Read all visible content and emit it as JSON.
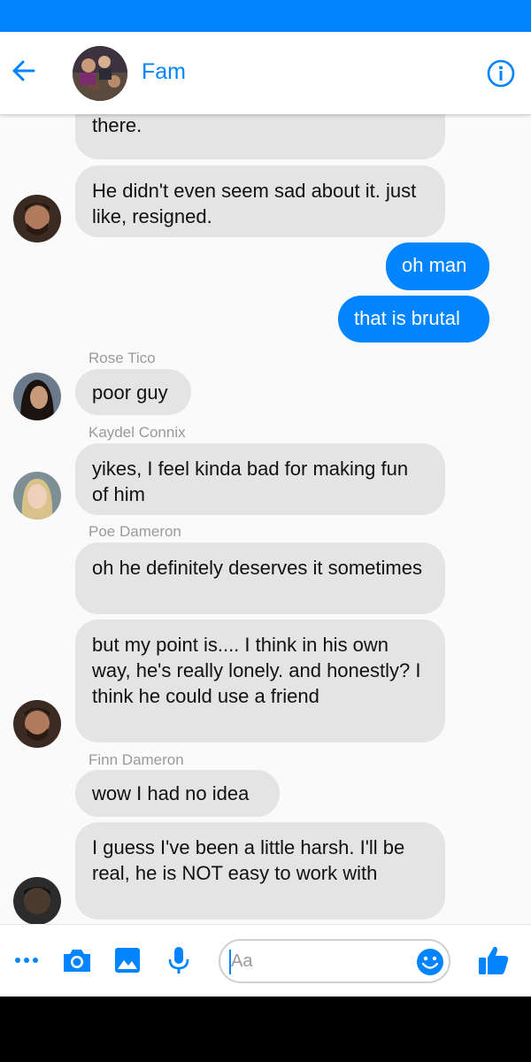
{
  "header": {
    "title": "Fam",
    "back_icon": "arrow-left-icon",
    "info_icon": "info-circle-icon"
  },
  "colors": {
    "accent": "#0084ff",
    "bubble_in": "#e4e4e4",
    "bubble_out": "#0084ff",
    "sender_text": "#9a9a9a"
  },
  "messages": [
    {
      "direction": "in",
      "sender": "",
      "text": "and that it was better if he wasn't there."
    },
    {
      "direction": "in",
      "sender": "",
      "text": "He didn't even seem sad about it. just like, resigned."
    },
    {
      "direction": "out",
      "text": "oh man"
    },
    {
      "direction": "out",
      "text": "that is brutal"
    },
    {
      "direction": "in",
      "sender": "Rose Tico",
      "text": "poor guy"
    },
    {
      "direction": "in",
      "sender": "Kaydel Connix",
      "text": "yikes, I feel kinda bad for making fun of him"
    },
    {
      "direction": "in",
      "sender": "Poe Dameron",
      "text": "oh he definitely deserves it sometimes"
    },
    {
      "direction": "in",
      "sender": "",
      "text": "but my point is.... I think in his own way, he's really lonely.  and honestly?  I think he could use a friend"
    },
    {
      "direction": "in",
      "sender": "Finn Dameron",
      "text": "wow I had no idea"
    },
    {
      "direction": "in",
      "sender": "",
      "text": "I guess I've been a little harsh.  I'll be real, he is NOT easy to work with"
    }
  ],
  "composer": {
    "placeholder": "Aa",
    "icons": [
      "more-icon",
      "camera-icon",
      "image-icon",
      "microphone-icon",
      "emoji-icon",
      "thumbs-up-icon"
    ]
  }
}
